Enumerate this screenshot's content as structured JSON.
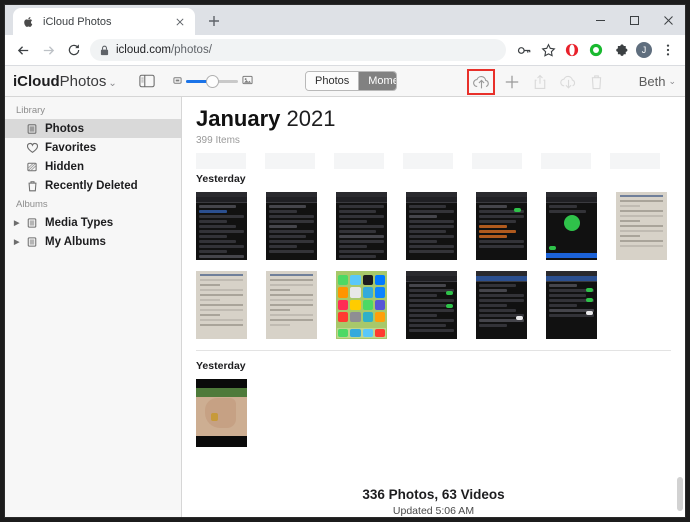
{
  "browser": {
    "tab": {
      "title": "iCloud Photos",
      "favicon_icon": "apple-logo-icon",
      "close_icon": "close-icon"
    },
    "new_tab_icon": "plus-icon",
    "window_controls": {
      "minimize": "minimize-icon",
      "maximize": "maximize-icon",
      "close": "close-icon"
    },
    "nav": {
      "back_icon": "back-arrow-icon",
      "forward_icon": "forward-arrow-icon",
      "reload_icon": "reload-icon",
      "lock_icon": "lock-icon",
      "url_domain": "icloud.com",
      "url_path": "/photos/"
    },
    "toolbar_icons": [
      "key-icon",
      "star-icon",
      "opera-extension-icon",
      "green-circle-extension-icon",
      "puzzle-extension-icon"
    ],
    "profile_initial": "J",
    "menu_icon": "three-dot-menu-icon"
  },
  "app": {
    "brand_primary": "iCloud",
    "brand_service": "Photos",
    "brand_chevron": "⌄",
    "sidebar_toggle_icon": "sidebar-toggle-icon",
    "zoom_slider": {
      "small_icon": "small-thumbnail-icon",
      "large_icon": "large-thumbnail-icon",
      "value_percent": 40
    },
    "segmented": {
      "option_photos": "Photos",
      "option_moments": "Mome"
    },
    "actions": {
      "upload": "Upload",
      "upload_icon": "cloud-upload-icon",
      "add": "Add",
      "add_icon": "plus-icon",
      "share": "Share",
      "share_icon": "share-icon",
      "download": "Download",
      "download_icon": "cloud-download-icon",
      "delete": "Delete",
      "delete_icon": "trash-icon",
      "highlight_color": "#e8302a"
    },
    "account_name": "Beth",
    "account_chevron": "⌄"
  },
  "sidebar": {
    "sections": [
      {
        "label": "Library",
        "items": [
          {
            "label": "Photos",
            "icon": "photos-icon",
            "selected": true
          },
          {
            "label": "Favorites",
            "icon": "heart-icon",
            "selected": false
          },
          {
            "label": "Hidden",
            "icon": "hidden-icon",
            "selected": false
          },
          {
            "label": "Recently Deleted",
            "icon": "trash-icon",
            "selected": false
          }
        ]
      },
      {
        "label": "Albums",
        "items": [
          {
            "label": "Media Types",
            "icon": "album-icon",
            "selected": false,
            "expandable": true
          },
          {
            "label": "My Albums",
            "icon": "album-icon",
            "selected": false,
            "expandable": true
          }
        ]
      }
    ]
  },
  "content": {
    "month": "January",
    "year": "2021",
    "items_count": "399 Items",
    "day_header_1": "Yesterday",
    "day_header_2": "Yesterday",
    "footer_main": "336 Photos, 63 Videos",
    "footer_sub": "Updated 5:06 AM",
    "groups": [
      {
        "header": "Yesterday",
        "rows": [
          [
            "chat-dark-screenshot",
            "message-compose-screenshot",
            "settings-list-screenshot",
            "settings-dark-screenshot",
            "settings-toggle-screenshot",
            "call-screen-screenshot",
            "handwritten-note-photo"
          ],
          [
            "handwritten-note-photo",
            "handwritten-note-photo",
            "ios-home-screen",
            "settings-dark-screenshot",
            "settings-list-screenshot",
            "settings-toggle-screenshot"
          ]
        ]
      },
      {
        "header": "Yesterday",
        "rows": [
          [
            "hand-outdoor-photo"
          ]
        ]
      }
    ]
  }
}
